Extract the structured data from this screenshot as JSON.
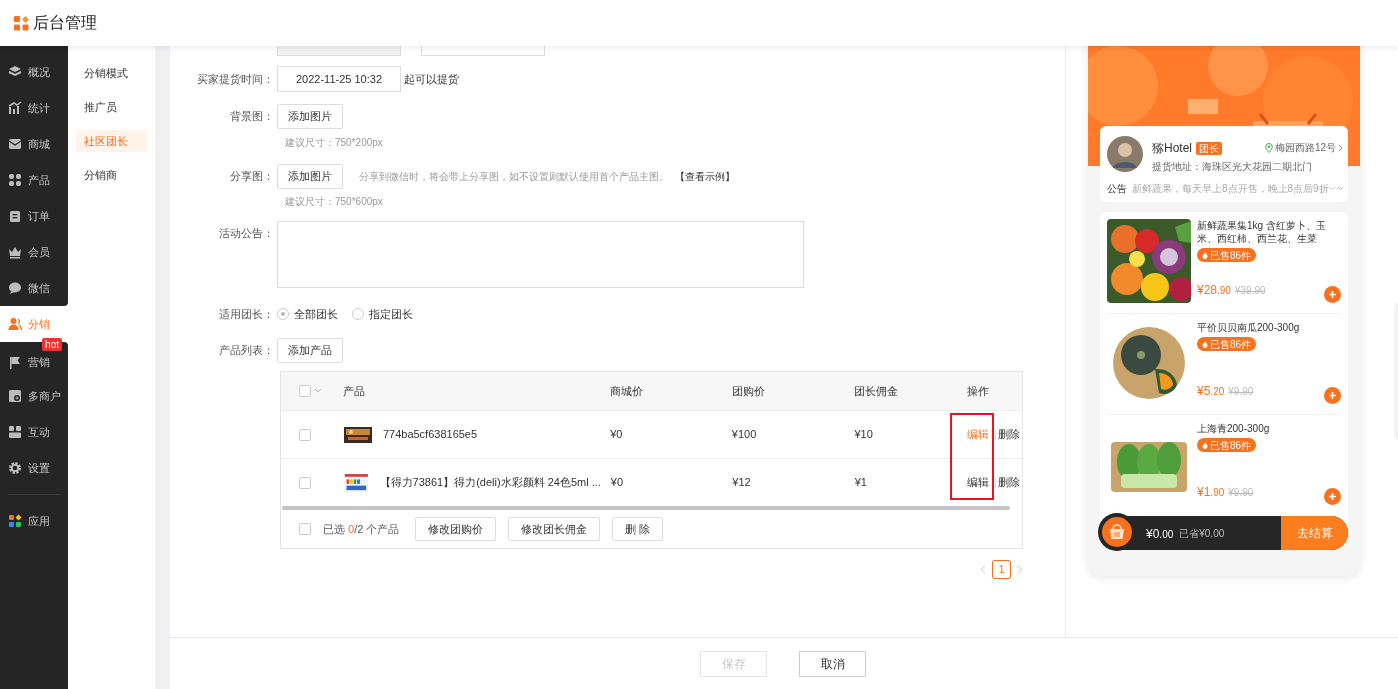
{
  "header": {
    "title": "后台管理"
  },
  "sidebar": {
    "items": [
      {
        "label": "概况",
        "selected": false
      },
      {
        "label": "统计",
        "selected": false
      },
      {
        "label": "商城",
        "selected": false
      },
      {
        "label": "产品",
        "selected": false
      },
      {
        "label": "订单",
        "selected": false
      },
      {
        "label": "会员",
        "selected": false
      },
      {
        "label": "微信",
        "selected": false
      },
      {
        "label": "分销",
        "selected": true
      },
      {
        "label": "营销",
        "selected": false,
        "badge": "hot"
      },
      {
        "label": "多商户",
        "selected": false
      },
      {
        "label": "互动",
        "selected": false
      },
      {
        "label": "设置",
        "selected": false
      },
      {
        "label": "应用",
        "selected": false,
        "divider_before": true
      }
    ]
  },
  "submenu": {
    "items": [
      {
        "label": "分销模式",
        "selected": false
      },
      {
        "label": "推广员",
        "selected": false
      },
      {
        "label": "社区团长",
        "selected": true
      },
      {
        "label": "分销商",
        "selected": false
      }
    ]
  },
  "form": {
    "pickup": {
      "label": "买家提货时间：",
      "value": "2022-11-25 10:32",
      "suffix": "起可以提货"
    },
    "background": {
      "label": "背景图：",
      "button": "添加图片",
      "hint": "建议尺寸：750*200px"
    },
    "share": {
      "label": "分享图：",
      "button": "添加图片",
      "note": "分享到微信时，将会带上分享图，如不设置则默认使用首个产品主图。",
      "link": "【查看示例】",
      "hint": "建议尺寸：750*600px"
    },
    "notice": {
      "label": "活动公告："
    },
    "leaders": {
      "label": "适用团长：",
      "options": [
        {
          "label": "全部团长",
          "selected": true
        },
        {
          "label": "指定团长",
          "selected": false
        }
      ]
    },
    "products": {
      "label": "产品列表：",
      "button": "添加产品"
    }
  },
  "table": {
    "select_all_checked": false,
    "columns": [
      "产品",
      "商城价",
      "团购价",
      "团长佣金",
      "操作"
    ],
    "rows": [
      {
        "checked": false,
        "name": "774ba5cf638165e5",
        "mall_price": "¥0",
        "group_price": "¥100",
        "commission": "¥10",
        "actions": [
          {
            "label": "编辑",
            "highlighted": true
          },
          {
            "label": "删除",
            "highlighted": false
          }
        ]
      },
      {
        "checked": false,
        "name": "【得力73861】得力(deli)水彩颜料 24色5ml ...",
        "mall_price": "¥0",
        "group_price": "¥12",
        "commission": "¥1",
        "actions": [
          {
            "label": "编辑",
            "highlighted": false
          },
          {
            "label": "删除",
            "highlighted": false
          }
        ]
      }
    ],
    "footer": {
      "checked": false,
      "prefix": "已选 ",
      "count": "0",
      "suffix": "/2 个产品",
      "buttons": [
        "修改团购价",
        "修改团长佣金",
        "删 除"
      ]
    }
  },
  "pagination": {
    "pages": [
      {
        "label": "1",
        "selected": true
      }
    ]
  },
  "actions": {
    "save": {
      "label": "保存",
      "disabled": true
    },
    "cancel": {
      "label": "取消",
      "disabled": false
    }
  },
  "preview": {
    "leader": {
      "name": "猕Hotel",
      "tag": "团长",
      "location": "梅园西路12号",
      "address": "提货地址：海珠区光大花园二期北门",
      "notice_label": "公告",
      "notice": "新鲜蔬果，每天早上8点开售，晚上8点后9折⋯"
    },
    "products": [
      {
        "name": "新鲜蔬果集1kg 含红萝卜、玉米、西红柿、西兰花、生菜",
        "sold": "已售86件",
        "price": "¥28",
        "decimals": ".90",
        "original": "¥39.90"
      },
      {
        "name": "平价贝贝南瓜200-300g",
        "sold": "已售86件",
        "price": "¥5",
        "decimals": ".20",
        "original": "¥9.90"
      },
      {
        "name": "上海青200-300g",
        "sold": "已售86件",
        "price": "¥1",
        "decimals": ".90",
        "original": "¥9.90"
      }
    ],
    "cart": {
      "total": "¥0",
      "decimals": ".00",
      "saved": "已省¥0.00",
      "checkout": "去结算"
    }
  }
}
